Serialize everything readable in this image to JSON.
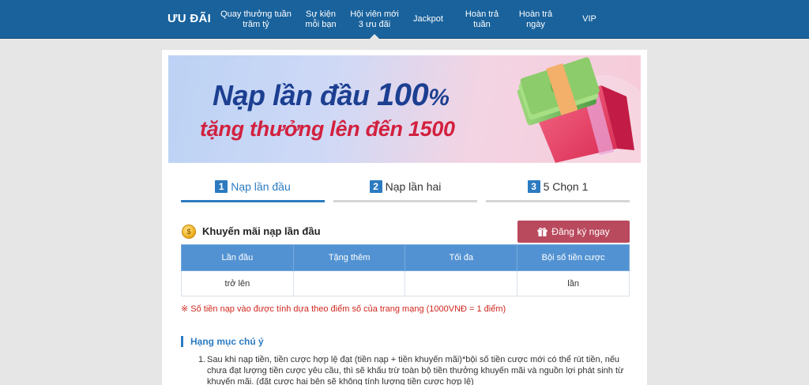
{
  "nav": {
    "brand": "ƯU ĐÃI",
    "items": [
      {
        "label": "Quay thưởng tuần\ntrăm tỷ"
      },
      {
        "label": "Sự kiện\nmỗi bạn"
      },
      {
        "label": "Hội viên mới\n3 ưu đãi"
      },
      {
        "label": "Jackpot"
      },
      {
        "label": "Hoàn trả\ntuần"
      },
      {
        "label": "Hoàn trả\nngày"
      },
      {
        "label": "VIP"
      }
    ]
  },
  "banner": {
    "line1_prefix": "Nạp lần đầu ",
    "line1_number": "100",
    "line1_percent": "%",
    "line2": "tặng thưởng lên đến 1500"
  },
  "tabs": [
    {
      "num": "1",
      "label": "Nạp lần đầu"
    },
    {
      "num": "2",
      "label": "Nạp lần hai"
    },
    {
      "num": "3",
      "label": "5 Chọn 1"
    }
  ],
  "promo": {
    "coin_glyph": "$",
    "title": "Khuyến mãi nạp lần đầu",
    "register_label": "Đăng ký ngay",
    "table": {
      "headers": [
        "Lần đầu",
        "Tặng thêm",
        "Tối đa",
        "Bội số tiền cược"
      ],
      "row": [
        "trở lên",
        "",
        "",
        "lần"
      ]
    },
    "note": "※ Số tiền nạp vào được tính dựa theo điểm số của trang mạng (1000VNĐ = 1 điểm)"
  },
  "notes_section": {
    "title": "Hạng mục chú ý",
    "items": [
      {
        "num": "1.",
        "text": "Sau khi nạp tiền, tiền cược hợp lệ đạt (tiền nạp + tiền khuyến mãi)*bội số tiền cược mới có thể rút tiền, nếu chưa đạt lượng tiền cược yêu cầu, thì sẽ khấu trừ toàn bộ tiền thưởng khuyến mãi và nguồn lợi phát sinh từ khuyến mãi. (đặt cược hai bên sẽ không tính lượng tiền cược hợp lệ)"
      }
    ]
  },
  "colors": {
    "nav_bg": "#19629c",
    "accent": "#2c7bc1",
    "register_btn": "#b9495d",
    "table_header": "#5292d2",
    "note_red": "#d0271e"
  }
}
